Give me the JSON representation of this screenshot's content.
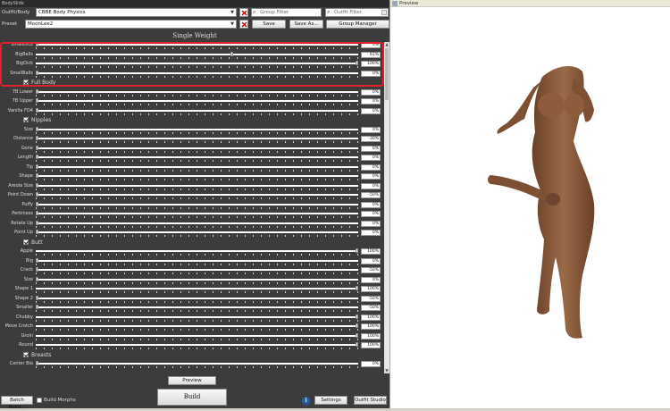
{
  "window": {
    "title": "BodySlide"
  },
  "top": {
    "outfit_label": "Outfit/Body",
    "outfit_value": "CBBE Body Physics",
    "preset_label": "Preset",
    "preset_value": "MoonLee2",
    "group_filter_placeholder": "Group Filter",
    "outfit_filter_placeholder": "Outfit Filter",
    "save_label": "Save",
    "save_as_label": "Save As...",
    "group_manager_label": "Group Manager"
  },
  "section_title": "Single Weight",
  "sliders_top": [
    {
      "label": "SmallDick",
      "value": "0%",
      "pos": 0
    },
    {
      "label": "BigBalls",
      "value": "61%",
      "pos": 61
    },
    {
      "label": "BigDick",
      "value": "100%",
      "pos": 100
    },
    {
      "label": "SmallBalls",
      "value": "0%",
      "pos": 0
    },
    {
      "label": "7B Lower",
      "value": "0%",
      "pos": 0
    },
    {
      "label": "7B Upper",
      "value": "0%",
      "pos": 0
    },
    {
      "label": "Vanilla FO4",
      "value": "0%",
      "pos": 0
    }
  ],
  "cat_full_body": "Full Body",
  "cat_nipples": "Nipples",
  "sliders_nipples": [
    {
      "label": "Size",
      "value": "0%",
      "pos": 0
    },
    {
      "label": "Distance",
      "value": "-30%",
      "pos": 0
    },
    {
      "label": "Gone",
      "value": "0%",
      "pos": 0
    },
    {
      "label": "Length",
      "value": "0%",
      "pos": 0
    },
    {
      "label": "Tip",
      "value": "0%",
      "pos": 0
    },
    {
      "label": "Shape",
      "value": "0%",
      "pos": 0
    },
    {
      "label": "Areola Size",
      "value": "0%",
      "pos": 0
    },
    {
      "label": "Point Down",
      "value": "-50%",
      "pos": 0
    },
    {
      "label": "Puffy",
      "value": "0%",
      "pos": 0
    },
    {
      "label": "Perkiness",
      "value": "0%",
      "pos": 0
    },
    {
      "label": "Rotate Up",
      "value": "0%",
      "pos": 0
    },
    {
      "label": "Point Up",
      "value": "0%",
      "pos": 0
    }
  ],
  "cat_butt": "Butt",
  "sliders_butt": [
    {
      "label": "Apple",
      "value": "100%",
      "pos": 100
    },
    {
      "label": "Big",
      "value": "0%",
      "pos": 0
    },
    {
      "label": "Crack",
      "value": "-50%",
      "pos": 0
    },
    {
      "label": "Size",
      "value": "0%",
      "pos": 0
    },
    {
      "label": "Shape 1",
      "value": "100%",
      "pos": 100
    },
    {
      "label": "Shape 2",
      "value": "-50%",
      "pos": 0
    },
    {
      "label": "Smaller",
      "value": "-50%",
      "pos": 0
    },
    {
      "label": "Chubby",
      "value": "100%",
      "pos": 100
    },
    {
      "label": "Move Crotch",
      "value": "100%",
      "pos": 100
    },
    {
      "label": "Groin",
      "value": "100%",
      "pos": 100
    },
    {
      "label": "Round",
      "value": "100%",
      "pos": 100
    }
  ],
  "cat_breasts": "Breasts",
  "sliders_breasts": [
    {
      "label": "Center Bio",
      "value": "0%",
      "pos": 0
    }
  ],
  "bottom": {
    "preview_label": "Preview",
    "build_label": "Build",
    "batch_build_label": "Batch Build...",
    "build_morphs_label": "Build Morphs",
    "settings_label": "Settings",
    "outfit_studio_label": "Outfit Studio",
    "info_glyph": "i"
  },
  "preview_panel": {
    "title": "Preview"
  },
  "colors": {
    "panel": "#3c3c3c",
    "highlight": "#e0202a",
    "skin": "#8a5a3c"
  }
}
